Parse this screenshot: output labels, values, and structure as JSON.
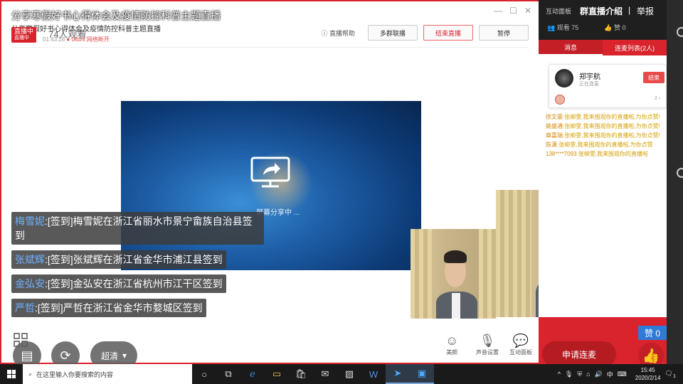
{
  "window": {
    "title": "分享寒假好书心得体会及疫情防控科普主题直播",
    "minimize": "—",
    "maximize": "☐",
    "close": "✕"
  },
  "live": {
    "inner_title": "分享寒假好书心得体会及疫情防控科普主题直播",
    "badge": "直播中",
    "badge_sub": "直播中",
    "audience": "74人观看",
    "elapsed": "01:43:28",
    "rate": "0kb/s 网络断开",
    "help": "直播帮助",
    "multi_stream": "多群联播",
    "end_live": "结束直播",
    "pause": "暂停"
  },
  "screen_share": {
    "status": "屏幕分享中 ..."
  },
  "danmaku": [
    {
      "name": "梅雪妮",
      "text": ":[签到]梅雪妮在浙江省丽水市景宁畲族自治县签到"
    },
    {
      "name": "张斌辉",
      "text": ":[签到]张斌辉在浙江省金华市浦江县签到"
    },
    {
      "name": "金弘安",
      "text": ":[签到]金弘安在浙江省杭州市江干区签到"
    },
    {
      "name": "严哲",
      "text": ":[签到]严哲在浙江省金华市婺城区签到"
    }
  ],
  "controls": {
    "clarity": "超清",
    "face": "美颜",
    "audio": "声音设置",
    "interact": "互动面板"
  },
  "panel": {
    "tab_label": "互动面板",
    "title": "群直播介绍",
    "separator": "|",
    "report": "举报",
    "viewers": "观看 75",
    "likes": "赞 0",
    "tab_messages": "消息",
    "tab_mic_list": "连麦列表(2人)",
    "mic_user": "郑宇航",
    "mic_status": "正在连麦",
    "end_label": "结束",
    "mic_count": "2",
    "chat": [
      {
        "name": "徐文豪",
        "text": ":张柳雯,我来围观你的直播啦,为你点赞!"
      },
      {
        "name": "姚盛通",
        "text": ":张柳雯,我来围观你的直播啦,为你点赞!"
      },
      {
        "name": "章嘉瑞",
        "text": ":张柳雯,我来围观你的直播啦,为你点赞!"
      },
      {
        "name": "陈潇",
        "text": ":张柳雯,我来围观你的直播啦,为你点赞"
      },
      {
        "name": "138****7093",
        "text": ":张柳雯,我来围观你的直播啦"
      }
    ],
    "apply_mic": "申请连麦",
    "like_count": "赞 0"
  },
  "taskbar": {
    "search_placeholder": "在这里输入你要搜索的内容",
    "time": "15:45",
    "date": "2020/2/14",
    "ime": "中",
    "notifications": "1"
  },
  "colors": {
    "accent": "#d9232d",
    "danmaku_name": "#6fb0ff",
    "chat_text": "#d4a000"
  }
}
